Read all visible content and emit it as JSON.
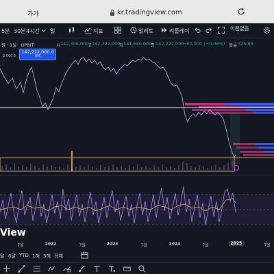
{
  "browser": {
    "aa_label": "가가",
    "url": "kr.tradingview.com"
  },
  "toolbar": {
    "interval_5m": "5분",
    "interval_4h": "4시간",
    "interval_day": "일",
    "indicators_label": "지표",
    "alert_label": "얼러트",
    "replay_label": "리플레이",
    "unnamed_label": "이름없음",
    "unnamed_sub": "-"
  },
  "symbol": {
    "name": "원 · 1날 · UPBIT",
    "open_label": "시",
    "open_value": "142,306,000",
    "high_label": "고",
    "high_value": "142,322,000",
    "low_label": "저",
    "low_value": "141,680,000",
    "close_label": "종",
    "close_value": "142,222,000",
    "change": "−80,000 (−0.06%)",
    "volume_label": "볼륨",
    "volume_value": "325.69"
  },
  "price_badge": {
    "price": "142,222,000.0",
    "sub": "매매"
  },
  "ref_label": "2,000.0",
  "logo_text": "View",
  "time_axis": {
    "ticks": [
      "7월",
      "2022",
      "7월",
      "2023",
      "7월",
      "2024",
      "7월",
      "2025",
      "7월"
    ]
  },
  "ranges": {
    "items": [
      "달",
      "6달",
      "YTD",
      "1해",
      "5해",
      "전체"
    ]
  },
  "colors": {
    "background": "#131722",
    "price_line": "#b39ddb",
    "rsi_line": "#a78bfa",
    "rsi_ma": "#f5c26b",
    "volume_profile_up": "#26a69a",
    "volume_profile_down": "#f23f9e",
    "box_line": "#e0a35a",
    "accent": "#2962ff"
  },
  "icons": [
    "lock-icon",
    "reload-icon",
    "chevron-down-icon",
    "bar-chart-icon",
    "indicators-icon",
    "layout-grid-icon",
    "alert-clock-icon",
    "replay-icon",
    "undo-icon",
    "redo-icon",
    "fullscreen-icon",
    "settings-icon",
    "calendar-range-icon",
    "crosshair-icon",
    "trend-line-icon",
    "fib-icon",
    "brush-icon",
    "text-icon",
    "pattern-icon",
    "forecast-icon",
    "measure-icon",
    "zoom-icon"
  ]
}
